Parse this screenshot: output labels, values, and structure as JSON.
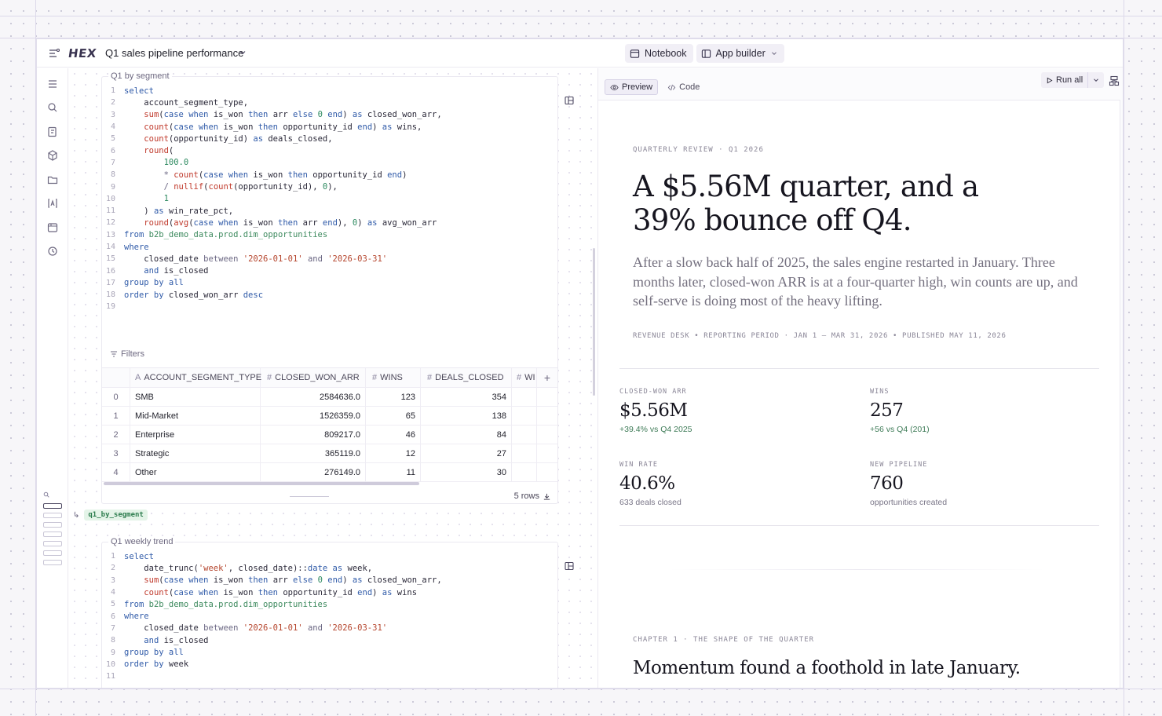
{
  "app": {
    "logo": "HEX",
    "project_title": "Q1 sales pipeline performance",
    "modes": [
      {
        "label": "Notebook",
        "icon": "notebook-icon"
      },
      {
        "label": "App builder",
        "icon": "app-builder-icon"
      }
    ]
  },
  "rail": {
    "icons": [
      "outline-icon",
      "search-icon",
      "data-browser-icon",
      "components-icon",
      "files-icon",
      "variables-icon",
      "environment-icon",
      "history-icon"
    ]
  },
  "cells": [
    {
      "label": "Q1 by segment",
      "code_lines": [
        [
          [
            "kw",
            "select"
          ]
        ],
        [
          [
            "t",
            "    account_segment_type,"
          ]
        ],
        [
          [
            "t",
            "    "
          ],
          [
            "fn",
            "sum"
          ],
          [
            "t",
            "("
          ],
          [
            "kw",
            "case when"
          ],
          [
            "t",
            " is_won "
          ],
          [
            "kw",
            "then"
          ],
          [
            "t",
            " arr "
          ],
          [
            "kw",
            "else"
          ],
          [
            "t",
            " "
          ],
          [
            "num",
            "0"
          ],
          [
            "t",
            " "
          ],
          [
            "kw",
            "end"
          ],
          [
            "t",
            ") "
          ],
          [
            "kw",
            "as"
          ],
          [
            "t",
            " closed_won_arr,"
          ]
        ],
        [
          [
            "t",
            "    "
          ],
          [
            "fn",
            "count"
          ],
          [
            "t",
            "("
          ],
          [
            "kw",
            "case when"
          ],
          [
            "t",
            " is_won "
          ],
          [
            "kw",
            "then"
          ],
          [
            "t",
            " opportunity_id "
          ],
          [
            "kw",
            "end"
          ],
          [
            "t",
            ") "
          ],
          [
            "kw",
            "as"
          ],
          [
            "t",
            " wins,"
          ]
        ],
        [
          [
            "t",
            "    "
          ],
          [
            "fn",
            "count"
          ],
          [
            "t",
            "(opportunity_id) "
          ],
          [
            "kw",
            "as"
          ],
          [
            "t",
            " deals_closed,"
          ]
        ],
        [
          [
            "t",
            "    "
          ],
          [
            "fn",
            "round"
          ],
          [
            "t",
            "("
          ]
        ],
        [
          [
            "t",
            "        "
          ],
          [
            "num",
            "100.0"
          ]
        ],
        [
          [
            "t",
            "        "
          ],
          [
            "op",
            "*"
          ],
          [
            "t",
            " "
          ],
          [
            "fn",
            "count"
          ],
          [
            "t",
            "("
          ],
          [
            "kw",
            "case when"
          ],
          [
            "t",
            " is_won "
          ],
          [
            "kw",
            "then"
          ],
          [
            "t",
            " opportunity_id "
          ],
          [
            "kw",
            "end"
          ],
          [
            "t",
            ")"
          ]
        ],
        [
          [
            "t",
            "        "
          ],
          [
            "op",
            "/"
          ],
          [
            "t",
            " "
          ],
          [
            "fn",
            "nullif"
          ],
          [
            "t",
            "("
          ],
          [
            "fn",
            "count"
          ],
          [
            "t",
            "(opportunity_id), "
          ],
          [
            "num",
            "0"
          ],
          [
            "t",
            "),"
          ]
        ],
        [
          [
            "t",
            "        "
          ],
          [
            "num",
            "1"
          ]
        ],
        [
          [
            "t",
            "    ) "
          ],
          [
            "kw",
            "as"
          ],
          [
            "t",
            " win_rate_pct,"
          ]
        ],
        [
          [
            "t",
            "    "
          ],
          [
            "fn",
            "round"
          ],
          [
            "t",
            "("
          ],
          [
            "fn",
            "avg"
          ],
          [
            "t",
            "("
          ],
          [
            "kw",
            "case when"
          ],
          [
            "t",
            " is_won "
          ],
          [
            "kw",
            "then"
          ],
          [
            "t",
            " arr "
          ],
          [
            "kw",
            "end"
          ],
          [
            "t",
            "), "
          ],
          [
            "num",
            "0"
          ],
          [
            "t",
            ") "
          ],
          [
            "kw",
            "as"
          ],
          [
            "t",
            " avg_won_arr"
          ]
        ],
        [
          [
            "kw",
            "from"
          ],
          [
            "t",
            " "
          ],
          [
            "tbl",
            "b2b_demo_data.prod.dim_opportunities"
          ]
        ],
        [
          [
            "kw",
            "where"
          ]
        ],
        [
          [
            "t",
            "    closed_date "
          ],
          [
            "op",
            "between"
          ],
          [
            "t",
            " "
          ],
          [
            "str",
            "'2026-01-01'"
          ],
          [
            "t",
            " "
          ],
          [
            "op",
            "and"
          ],
          [
            "t",
            " "
          ],
          [
            "str",
            "'2026-03-31'"
          ]
        ],
        [
          [
            "t",
            "    "
          ],
          [
            "kw",
            "and"
          ],
          [
            "t",
            " is_closed"
          ]
        ],
        [
          [
            "kw",
            "group by all"
          ]
        ],
        [
          [
            "kw",
            "order by"
          ],
          [
            "t",
            " closed_won_arr "
          ],
          [
            "kw",
            "desc"
          ]
        ],
        [
          [
            "t",
            ""
          ]
        ]
      ],
      "filters_label": "Filters",
      "table": {
        "columns": [
          "ACCOUNT_SEGMENT_TYPE",
          "CLOSED_WON_ARR",
          "WINS",
          "DEALS_CLOSED",
          "WI"
        ],
        "rows": [
          {
            "idx": "0",
            "segment": "SMB",
            "arr": "2584636.0",
            "wins": "123",
            "deals": "354"
          },
          {
            "idx": "1",
            "segment": "Mid-Market",
            "arr": "1526359.0",
            "wins": "65",
            "deals": "138"
          },
          {
            "idx": "2",
            "segment": "Enterprise",
            "arr": "809217.0",
            "wins": "46",
            "deals": "84"
          },
          {
            "idx": "3",
            "segment": "Strategic",
            "arr": "365119.0",
            "wins": "12",
            "deals": "27"
          },
          {
            "idx": "4",
            "segment": "Other",
            "arr": "276149.0",
            "wins": "11",
            "deals": "30"
          }
        ],
        "row_count": "5 rows"
      },
      "output_var": "q1_by_segment"
    },
    {
      "label": "Q1 weekly trend",
      "code_lines": [
        [
          [
            "kw",
            "select"
          ]
        ],
        [
          [
            "t",
            "    date_trunc("
          ],
          [
            "str",
            "'week'"
          ],
          [
            "t",
            ", closed_date)::"
          ],
          [
            "kw",
            "date"
          ],
          [
            "t",
            " "
          ],
          [
            "kw",
            "as"
          ],
          [
            "t",
            " week,"
          ]
        ],
        [
          [
            "t",
            "    "
          ],
          [
            "fn",
            "sum"
          ],
          [
            "t",
            "("
          ],
          [
            "kw",
            "case when"
          ],
          [
            "t",
            " is_won "
          ],
          [
            "kw",
            "then"
          ],
          [
            "t",
            " arr "
          ],
          [
            "kw",
            "else"
          ],
          [
            "t",
            " "
          ],
          [
            "num",
            "0"
          ],
          [
            "t",
            " "
          ],
          [
            "kw",
            "end"
          ],
          [
            "t",
            ") "
          ],
          [
            "kw",
            "as"
          ],
          [
            "t",
            " closed_won_arr,"
          ]
        ],
        [
          [
            "t",
            "    "
          ],
          [
            "fn",
            "count"
          ],
          [
            "t",
            "("
          ],
          [
            "kw",
            "case when"
          ],
          [
            "t",
            " is_won "
          ],
          [
            "kw",
            "then"
          ],
          [
            "t",
            " opportunity_id "
          ],
          [
            "kw",
            "end"
          ],
          [
            "t",
            ") "
          ],
          [
            "kw",
            "as"
          ],
          [
            "t",
            " wins"
          ]
        ],
        [
          [
            "kw",
            "from"
          ],
          [
            "t",
            " "
          ],
          [
            "tbl",
            "b2b_demo_data.prod.dim_opportunities"
          ]
        ],
        [
          [
            "kw",
            "where"
          ]
        ],
        [
          [
            "t",
            "    closed_date "
          ],
          [
            "op",
            "between"
          ],
          [
            "t",
            " "
          ],
          [
            "str",
            "'2026-01-01'"
          ],
          [
            "t",
            " "
          ],
          [
            "op",
            "and"
          ],
          [
            "t",
            " "
          ],
          [
            "str",
            "'2026-03-31'"
          ]
        ],
        [
          [
            "t",
            "    "
          ],
          [
            "kw",
            "and"
          ],
          [
            "t",
            " is_closed"
          ]
        ],
        [
          [
            "kw",
            "group by all"
          ]
        ],
        [
          [
            "kw",
            "order by"
          ],
          [
            "t",
            " week"
          ]
        ],
        [
          [
            "t",
            ""
          ]
        ]
      ]
    }
  ],
  "preview": {
    "tabs": [
      {
        "label": "Preview",
        "icon": "eye-icon",
        "active": true
      },
      {
        "label": "Code",
        "icon": "code-icon",
        "active": false
      }
    ],
    "run_all_label": "Run all",
    "eyebrow": "QUARTERLY REVIEW · Q1 2026",
    "headline": "A $5.56M quarter, and a 39% bounce off Q4.",
    "dek": "After a slow back half of 2025, the sales engine restarted in January. Three months later, closed-won ARR is at a four-quarter high, win counts are up, and self-serve is doing most of the heavy lifting.",
    "byline": "REVENUE DESK  •  REPORTING PERIOD · JAN 1 – MAR 31, 2026  •  PUBLISHED MAY 11, 2026",
    "kpis": [
      {
        "label": "CLOSED-WON ARR",
        "value": "$5.56M",
        "sub": "+39.4% vs Q4 2025",
        "tone": "pos"
      },
      {
        "label": "WINS",
        "value": "257",
        "sub": "+56 vs Q4 (201)",
        "tone": "pos"
      },
      {
        "label": "WIN RATE",
        "value": "40.6%",
        "sub": "633 deals closed",
        "tone": "neu"
      },
      {
        "label": "NEW PIPELINE",
        "value": "760",
        "sub": "opportunities created",
        "tone": "neu"
      }
    ],
    "chapter_eyebrow": "CHAPTER 1 · THE SHAPE OF THE QUARTER",
    "chapter_title": "Momentum found a foothold in late January."
  },
  "colors": {
    "accent": "#2f5aa8",
    "positive": "#3e7b57",
    "var_chip_bg": "#e4f4e8"
  }
}
